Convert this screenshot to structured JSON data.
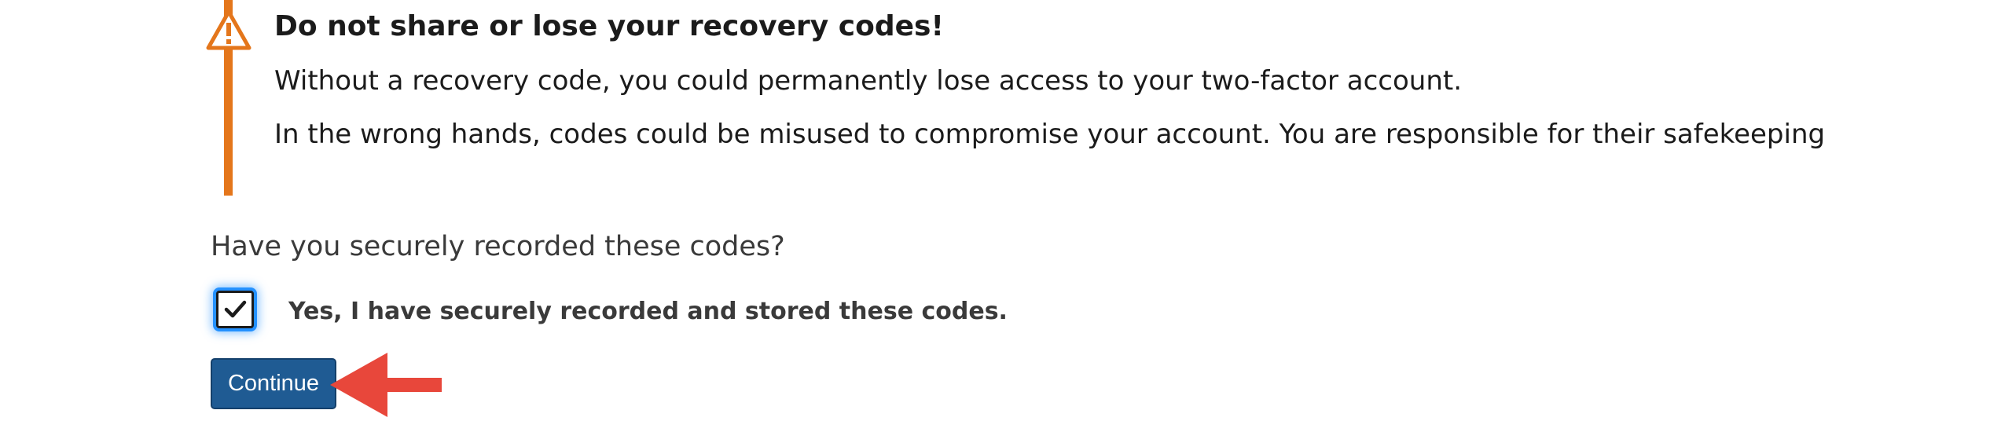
{
  "warning": {
    "icon": "warning-triangle-icon",
    "accent_color": "#e4761b",
    "title": "Do not share or lose your recovery codes!",
    "line1": "Without a recovery code, you could permanently lose access to your two-factor account.",
    "line2": "In the wrong hands, codes could be misused to compromise your account. You are responsible for their safekeeping"
  },
  "confirmation": {
    "question": "Have you securely recorded these codes?",
    "checkbox_checked": true,
    "checkbox_label": "Yes, I have securely recorded and stored these codes."
  },
  "actions": {
    "continue_label": "Continue",
    "button_color": "#1f5b93",
    "annotation_arrow_color": "#e8473b"
  }
}
